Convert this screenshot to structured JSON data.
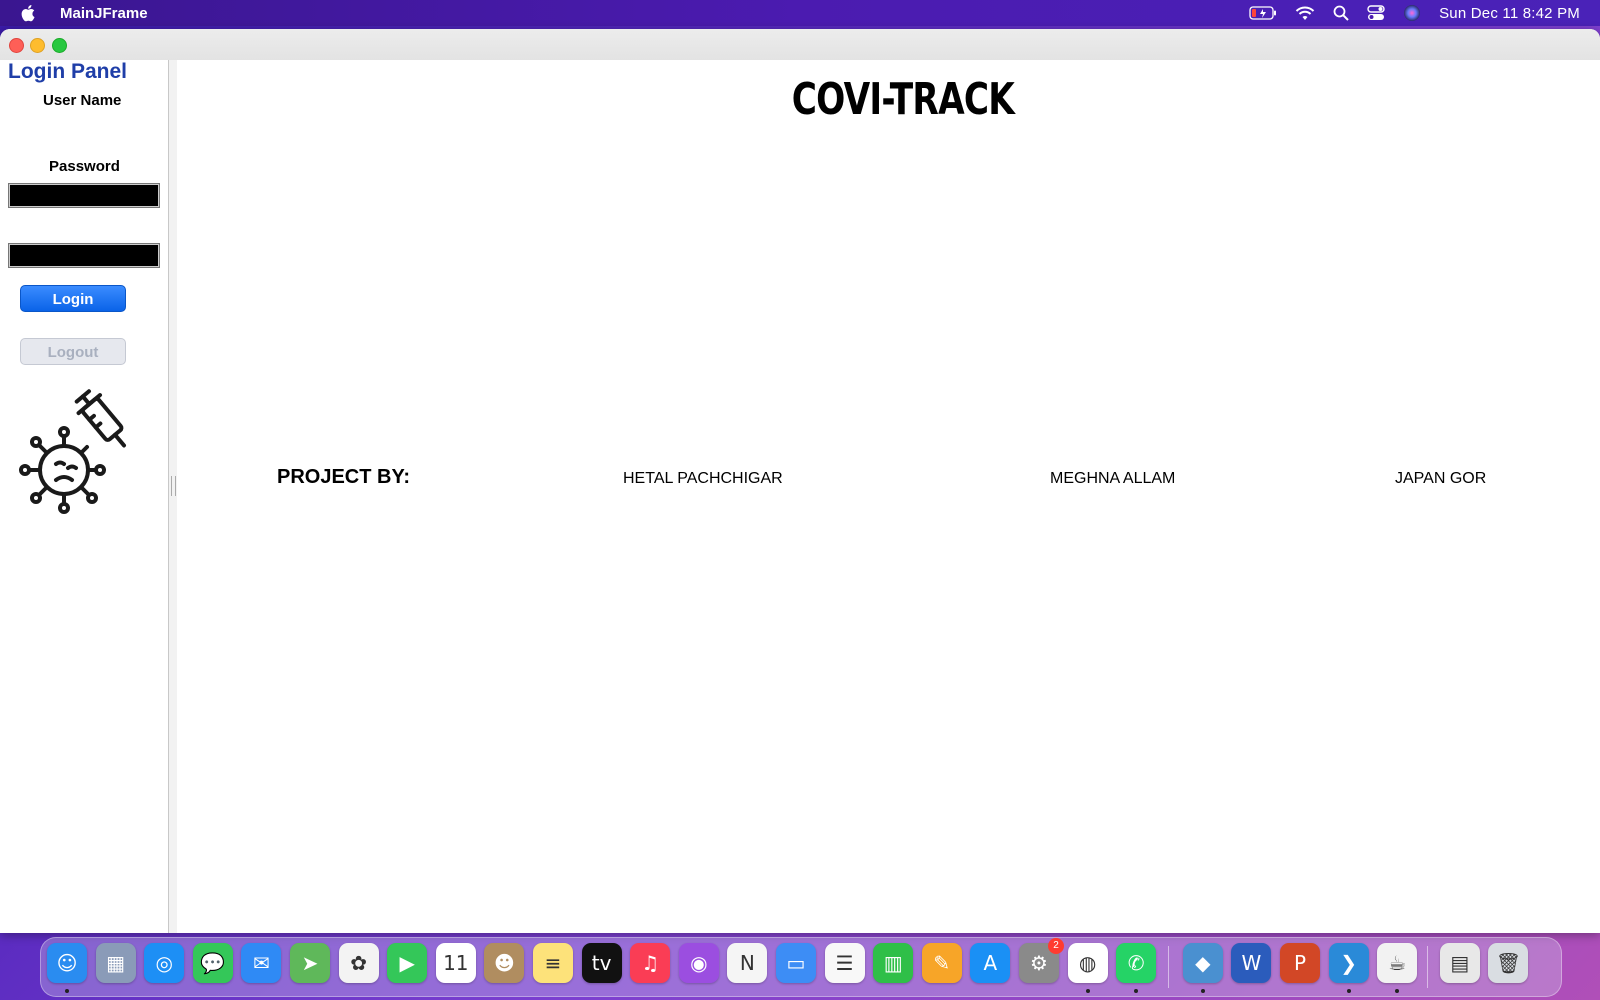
{
  "menubar": {
    "app_name": "MainJFrame",
    "clock": "Sun Dec 11  8:42 PM",
    "icons": [
      "apple-icon",
      "battery-icon",
      "wifi-icon",
      "search-icon",
      "control-center-icon",
      "siri-icon"
    ]
  },
  "login_panel": {
    "title": "Login Panel",
    "username_label": "User Name",
    "username_value": "",
    "password_label": "Password",
    "password_value": "",
    "login_button": "Login",
    "logout_button": "Logout",
    "logout_enabled": false
  },
  "main": {
    "title": "COVI-TRACK",
    "project_by_label": "PROJECT BY:",
    "members": [
      "HETAL PACHCHIGAR",
      "MEGHNA ALLAM",
      "JAPAN GOR"
    ]
  },
  "dock": {
    "items": [
      {
        "name": "finder",
        "color": "#2a8cf0",
        "glyph": "☺"
      },
      {
        "name": "launchpad",
        "color": "#8a9bb8",
        "glyph": "▦"
      },
      {
        "name": "safari",
        "color": "#1d8ff5",
        "glyph": "◎"
      },
      {
        "name": "messages",
        "color": "#34c759",
        "glyph": "💬"
      },
      {
        "name": "mail",
        "color": "#2f8af5",
        "glyph": "✉"
      },
      {
        "name": "maps",
        "color": "#5fb85a",
        "glyph": "➤"
      },
      {
        "name": "photos",
        "color": "#f3f3f3",
        "glyph": "✿"
      },
      {
        "name": "facetime",
        "color": "#34c759",
        "glyph": "▶"
      },
      {
        "name": "calendar",
        "color": "#ffffff",
        "glyph": "11"
      },
      {
        "name": "contacts",
        "color": "#b08d60",
        "glyph": "☻"
      },
      {
        "name": "notes",
        "color": "#fde27a",
        "glyph": "≡"
      },
      {
        "name": "apple-tv",
        "color": "#111111",
        "glyph": "tv"
      },
      {
        "name": "music",
        "color": "#fa3d55",
        "glyph": "♫"
      },
      {
        "name": "podcasts",
        "color": "#9b4ee0",
        "glyph": "◉"
      },
      {
        "name": "news",
        "color": "#f5f5f5",
        "glyph": "N"
      },
      {
        "name": "keynote",
        "color": "#3d8df5",
        "glyph": "▭"
      },
      {
        "name": "reminders",
        "color": "#f8f8f8",
        "glyph": "☰"
      },
      {
        "name": "numbers",
        "color": "#2fbf48",
        "glyph": "▥"
      },
      {
        "name": "pages",
        "color": "#f7a528",
        "glyph": "✎"
      },
      {
        "name": "app-store",
        "color": "#1a90f5",
        "glyph": "A"
      },
      {
        "name": "system-preferences",
        "color": "#8a8a8a",
        "glyph": "⚙",
        "badge": "2"
      },
      {
        "name": "chrome",
        "color": "#ffffff",
        "glyph": "◍"
      },
      {
        "name": "whatsapp",
        "color": "#25d366",
        "glyph": "✆"
      },
      {
        "name": "netbeans",
        "color": "#4a90d0",
        "glyph": "◆"
      },
      {
        "name": "word",
        "color": "#2b5cbc",
        "glyph": "W"
      },
      {
        "name": "powerpoint",
        "color": "#d24726",
        "glyph": "P"
      },
      {
        "name": "vscode",
        "color": "#2a8ad8",
        "glyph": "❯"
      },
      {
        "name": "java",
        "color": "#f2f2f2",
        "glyph": "☕"
      },
      {
        "name": "downloads-stack",
        "color": "#e8e8e8",
        "glyph": "▤"
      },
      {
        "name": "trash",
        "color": "#d9dde2",
        "glyph": "🗑"
      }
    ]
  }
}
